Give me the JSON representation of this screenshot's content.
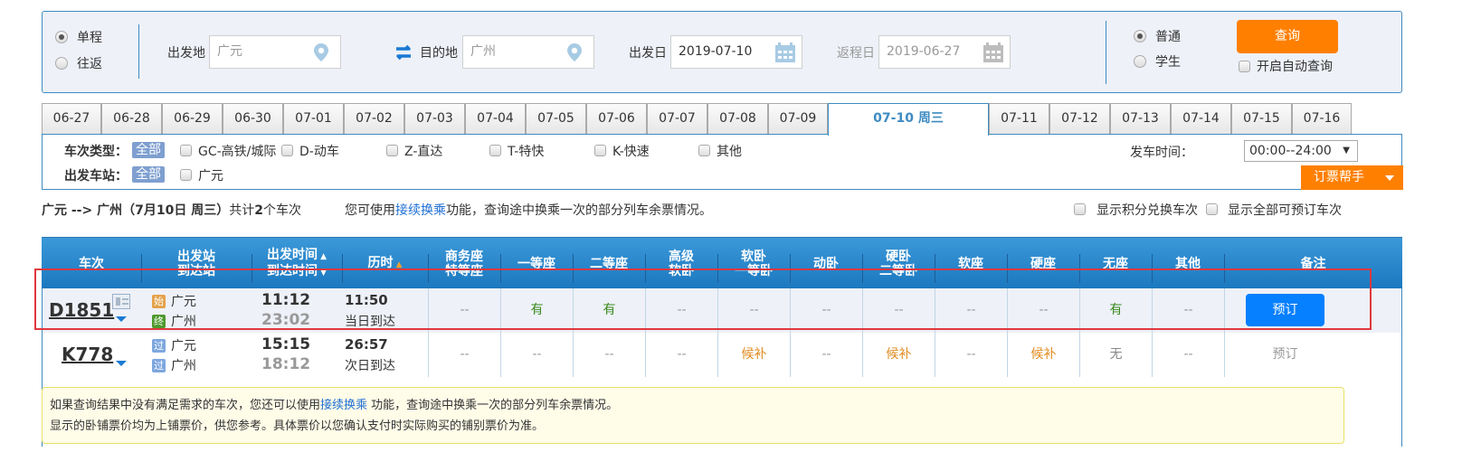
{
  "search": {
    "trip_type": [
      {
        "label": "单程",
        "checked": true
      },
      {
        "label": "往返",
        "checked": false
      }
    ],
    "from_label": "出发地",
    "from_value": "广元",
    "to_label": "目的地",
    "to_value": "广州",
    "depart_label": "出发日",
    "depart_value": "2019-07-10",
    "return_label": "返程日",
    "return_value": "2019-06-27",
    "passenger_type": [
      {
        "label": "普通",
        "checked": true
      },
      {
        "label": "学生",
        "checked": false
      }
    ],
    "query_button": "查询",
    "auto_query_label": "开启自动查询"
  },
  "date_tabs": [
    {
      "label": "06-27"
    },
    {
      "label": "06-28"
    },
    {
      "label": "06-29"
    },
    {
      "label": "06-30"
    },
    {
      "label": "07-01"
    },
    {
      "label": "07-02"
    },
    {
      "label": "07-03"
    },
    {
      "label": "07-04"
    },
    {
      "label": "07-05"
    },
    {
      "label": "07-06"
    },
    {
      "label": "07-07"
    },
    {
      "label": "07-08"
    },
    {
      "label": "07-09"
    },
    {
      "label": "07-10 周三",
      "active": true
    },
    {
      "label": "07-11"
    },
    {
      "label": "07-12"
    },
    {
      "label": "07-13"
    },
    {
      "label": "07-14"
    },
    {
      "label": "07-15"
    },
    {
      "label": "07-16"
    }
  ],
  "filters": {
    "train_type_label": "车次类型：",
    "all_label": "全部",
    "train_types": [
      "GC-高铁/城际",
      "D-动车",
      "Z-直达",
      "T-特快",
      "K-快速",
      "其他"
    ],
    "station_label": "出发车站：",
    "stations": [
      "广元"
    ],
    "depart_time_label": "发车时间：",
    "depart_time_value": "00:00--24:00",
    "helper_button": "订票帮手"
  },
  "summary": {
    "route": "广元 --> 广州（7月10日 周三）",
    "count_prefix": "共计",
    "count": "2",
    "count_suffix": "个车次",
    "tip_prefix": "您可使用",
    "tip_link": "接续换乘",
    "tip_suffix": "功能，查询途中换乘一次的部分列车余票情况。",
    "option1": "显示积分兑换车次",
    "option2": "显示全部可预订车次"
  },
  "table": {
    "headers": [
      {
        "l1": "车次"
      },
      {
        "l1": "出发站",
        "l2": "到达站"
      },
      {
        "l1": "出发时间",
        "l2": "到达时间"
      },
      {
        "l1": "历时"
      },
      {
        "l1": "商务座",
        "l2": "特等座"
      },
      {
        "l1": "一等座"
      },
      {
        "l1": "二等座"
      },
      {
        "l1": "高级",
        "l2": "软卧"
      },
      {
        "l1": "软卧",
        "l2": "一等卧"
      },
      {
        "l1": "动卧"
      },
      {
        "l1": "硬卧",
        "l2": "二等卧"
      },
      {
        "l1": "软座"
      },
      {
        "l1": "硬座"
      },
      {
        "l1": "无座"
      },
      {
        "l1": "其他"
      },
      {
        "l1": "备注"
      }
    ],
    "rows": [
      {
        "train_no": "D1851",
        "from_badge": "始",
        "from_station": "广元",
        "to_badge": "终",
        "to_station": "广州",
        "depart_time": "11:12",
        "arrive_time": "23:02",
        "duration": "11:50",
        "arrive_day": "当日到达",
        "seats": [
          "--",
          "有",
          "有",
          "--",
          "--",
          "--",
          "--",
          "--",
          "--",
          "有",
          "--"
        ],
        "action": "预订"
      },
      {
        "train_no": "K778",
        "from_badge": "过",
        "from_station": "广元",
        "to_badge": "过",
        "to_station": "广州",
        "depart_time": "15:15",
        "arrive_time": "18:12",
        "duration": "26:57",
        "arrive_day": "次日到达",
        "seats": [
          "--",
          "--",
          "--",
          "--",
          "候补",
          "--",
          "候补",
          "--",
          "候补",
          "无",
          "--"
        ],
        "action": "预订"
      }
    ]
  },
  "notice": {
    "line1_prefix": "如果查询结果中没有满足需求的车次，您还可以使用",
    "line1_link": "接续换乘",
    "line1_suffix": " 功能，查询途中换乘一次的部分列车余票情况。",
    "line2": "显示的卧铺票价均为上铺票价，供您参考。具体票价以您确认支付时实际购买的铺别票价为准。"
  },
  "colors": {
    "accent_blue": "#3f8bc2",
    "orange": "#ff8000",
    "book_blue": "#0680fe",
    "available_green": "#3a8a1e",
    "waitlist_orange": "#e08a1d",
    "highlight_red": "#e0383e"
  }
}
